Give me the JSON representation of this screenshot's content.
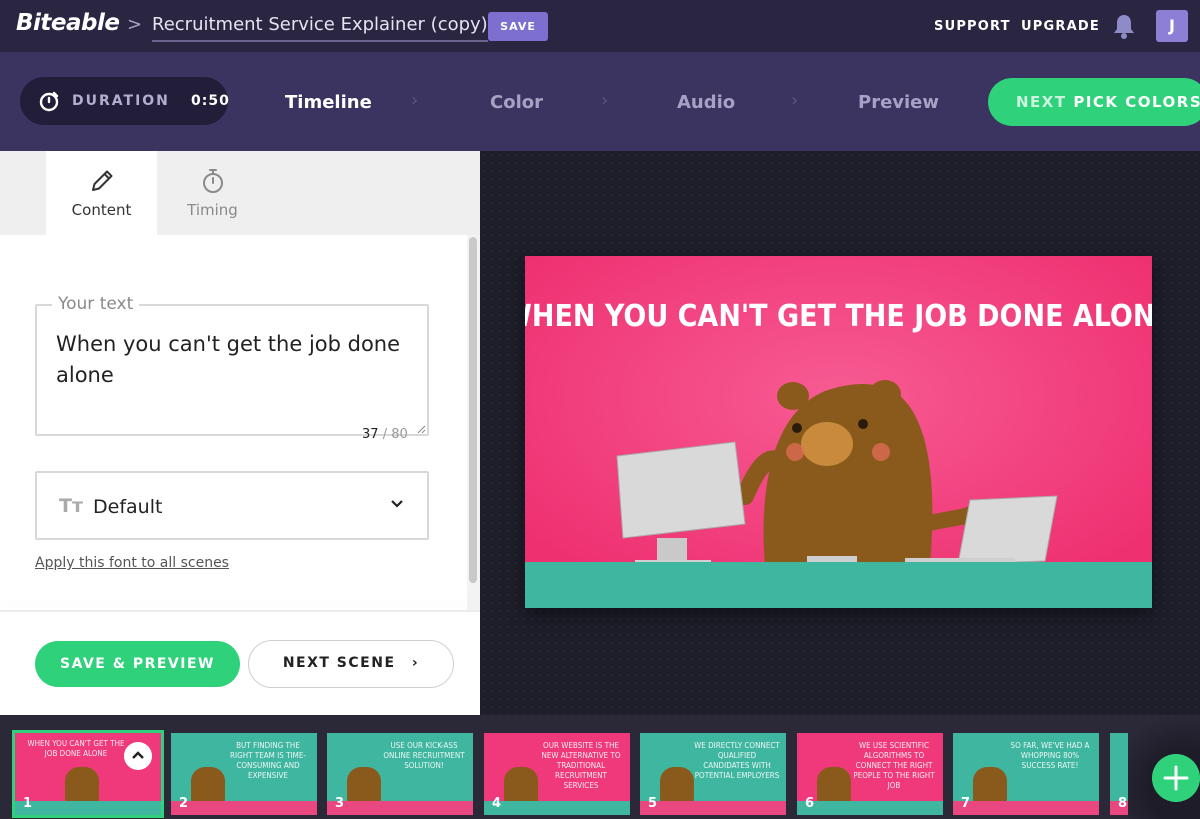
{
  "app": {
    "logo": "Biteable",
    "crumb_sep": ">"
  },
  "project": {
    "title": "Recruitment Service Explainer (copy)",
    "save_label": "SAVE"
  },
  "topnav": {
    "support": "SUPPORT",
    "upgrade": "UPGRADE",
    "avatar": "J"
  },
  "duration": {
    "label": "DURATION",
    "value": "0:50"
  },
  "steps": [
    {
      "label": "Timeline",
      "active": true
    },
    {
      "label": "Color",
      "active": false
    },
    {
      "label": "Audio",
      "active": false
    },
    {
      "label": "Preview",
      "active": false
    }
  ],
  "next": {
    "prefix": "NEXT",
    "label": "PICK COLORS"
  },
  "tabs": [
    {
      "label": "Content",
      "icon": "pencil-icon"
    },
    {
      "label": "Timing",
      "icon": "stopwatch-icon"
    }
  ],
  "text_field": {
    "legend": "Your text",
    "value": "When you can't get the job done alone",
    "count": "37",
    "max": "/ 80"
  },
  "font": {
    "icon": "Tт",
    "value": "Default",
    "apply_link": "Apply this font to all scenes"
  },
  "buttons": {
    "save_preview": "SAVE & PREVIEW",
    "next_scene": "NEXT SCENE"
  },
  "scene": {
    "caption": "WHEN YOU CAN'T GET THE JOB DONE ALONE",
    "bg": "#f0397a",
    "ground": "#3fb6a0"
  },
  "filmstrip": [
    {
      "num": "1",
      "caption": "WHEN YOU CAN'T GET THE JOB DONE ALONE",
      "bg": "#f0397a"
    },
    {
      "num": "2",
      "caption": "BUT FINDING THE RIGHT TEAM IS TIME-CONSUMING AND EXPENSIVE",
      "bg": "#3fb6a0"
    },
    {
      "num": "3",
      "caption": "USE OUR KICK-ASS ONLINE RECRUITMENT SOLUTION!",
      "bg": "#3fb6a0"
    },
    {
      "num": "4",
      "caption": "OUR WEBSITE IS THE NEW ALTERNATIVE TO TRADITIONAL RECRUITMENT SERVICES",
      "bg": "#f0397a"
    },
    {
      "num": "5",
      "caption": "WE DIRECTLY CONNECT QUALIFIED CANDIDATES WITH POTENTIAL EMPLOYERS",
      "bg": "#3fb6a0"
    },
    {
      "num": "6",
      "caption": "WE USE SCIENTIFIC ALGORITHMS TO CONNECT THE RIGHT PEOPLE TO THE RIGHT JOB",
      "bg": "#f0397a"
    },
    {
      "num": "7",
      "caption": "SO FAR, WE'VE HAD A WHOPPING 80% SUCCESS RATE!",
      "bg": "#3fb6a0"
    },
    {
      "num": "8",
      "caption": "",
      "bg": "#3fb6a0"
    }
  ],
  "colors": {
    "accent": "#2fd17a",
    "top": "#2a2541",
    "sub": "#3b3360",
    "save": "#7c6fd0"
  }
}
